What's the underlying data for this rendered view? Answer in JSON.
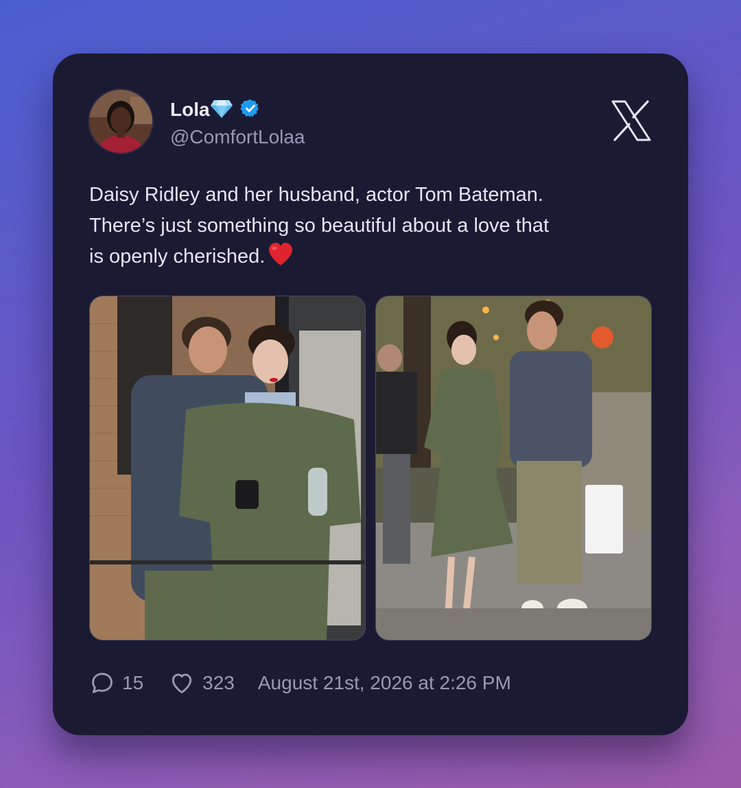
{
  "author": {
    "display_name": "Lola",
    "name_emoji": "💎",
    "verified_icon": "verified-badge-icon",
    "handle": "@ComfortLolaa"
  },
  "platform_icon": "x-logo-icon",
  "tweet": {
    "lines": [
      "Daisy Ridley and her husband, actor Tom Bateman.",
      "There’s just something so beautiful about a love that",
      "is openly cherished."
    ],
    "emoji": "heart-emoji"
  },
  "media": [
    {
      "icon": "photo-couple-building"
    },
    {
      "icon": "photo-couple-street"
    }
  ],
  "stats": {
    "replies": "15",
    "likes": "323",
    "timestamp": "August 21st, 2026 at 2:26 PM"
  },
  "colors": {
    "card_bg": "#1b1a33",
    "verified": "#1d9bf0",
    "text_primary": "#eceaf6",
    "text_secondary": "#9b98b4",
    "heart": "#e0242f"
  }
}
